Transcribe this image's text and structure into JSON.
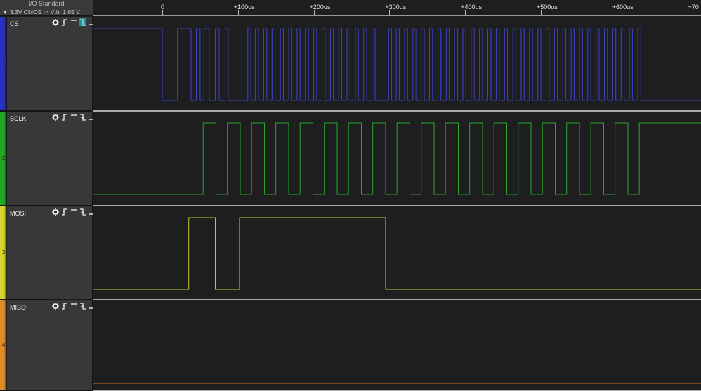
{
  "io": {
    "title": "I/O Standard",
    "value": "3.3V CMOS  -> Vth: 1.65 V"
  },
  "timeline": {
    "ticks": [
      "0",
      "+100us",
      "+200us",
      "+300us",
      "+400us",
      "+500us",
      "+600us",
      "+70"
    ],
    "tick_times_us": [
      0,
      100,
      200,
      300,
      400,
      500,
      600,
      700
    ]
  },
  "colors": {
    "cs": "#3a44c8",
    "sclk": "#2aa52a",
    "mosi": "#c8c828",
    "miso": "#d0761c"
  },
  "channels": [
    {
      "name": "CS",
      "number": "1",
      "strip_color": "#2832c0",
      "trace_color": "#3a44c8",
      "icons": [
        "gear-icon",
        "rising-edge-icon",
        "high-level-icon",
        "decoder-icon",
        "low-level-icon"
      ],
      "highlight_icon": 3
    },
    {
      "name": "SCLK",
      "number": "2",
      "strip_color": "#22a822",
      "trace_color": "#2aa52a",
      "icons": [
        "gear-icon",
        "rising-edge-icon",
        "high-level-icon",
        "falling-edge-icon",
        "low-level-icon"
      ],
      "highlight_icon": -1
    },
    {
      "name": "MOSI",
      "number": "3",
      "strip_color": "#d6d62a",
      "trace_color": "#c8c828",
      "icons": [
        "gear-icon",
        "rising-edge-icon",
        "high-level-icon",
        "falling-edge-icon",
        "low-level-icon"
      ],
      "highlight_icon": -1
    },
    {
      "name": "MISO",
      "number": "4",
      "strip_color": "#e08a2a",
      "trace_color": "#d0761c",
      "icons": [
        "gear-icon",
        "rising-edge-icon",
        "high-level-icon",
        "falling-edge-icon",
        "low-level-icon"
      ],
      "highlight_icon": -1
    }
  ],
  "signals": {
    "cs": {
      "initial": 1,
      "transitions_us": [
        0,
        20,
        38,
        45,
        50,
        55,
        62,
        70,
        75,
        83,
        87,
        113,
        117,
        123,
        127,
        134,
        138,
        145,
        149,
        156,
        160,
        167,
        171,
        178,
        182,
        189,
        193,
        200,
        204,
        211,
        215,
        222,
        226,
        233,
        237,
        244,
        248,
        255,
        259,
        266,
        270,
        277,
        281,
        299,
        303,
        309,
        313,
        320,
        324,
        331,
        335,
        342,
        346,
        353,
        357,
        364,
        368,
        375,
        379,
        386,
        390,
        397,
        401,
        408,
        412,
        419,
        423,
        430,
        434,
        441,
        445,
        452,
        456,
        463,
        467,
        474,
        478,
        485,
        489,
        496,
        500,
        507,
        511,
        518,
        522,
        529,
        533,
        540,
        544,
        551,
        555,
        562,
        566,
        573,
        577,
        584,
        588,
        595,
        599,
        606,
        610,
        617,
        621,
        628,
        632
      ]
    },
    "sclk": {
      "initial": 0,
      "transitions_us": [
        54,
        71,
        86,
        103,
        118,
        135,
        150,
        167,
        182,
        199,
        214,
        231,
        246,
        263,
        278,
        295,
        310,
        327,
        342,
        359,
        374,
        391,
        406,
        423,
        438,
        455,
        470,
        487,
        502,
        519,
        534,
        551,
        566,
        583,
        598,
        615,
        630
      ]
    },
    "mosi": {
      "initial": 0,
      "transitions_us": [
        35,
        70,
        102,
        295
      ]
    },
    "miso": {
      "initial": 0,
      "transitions_us": []
    }
  }
}
